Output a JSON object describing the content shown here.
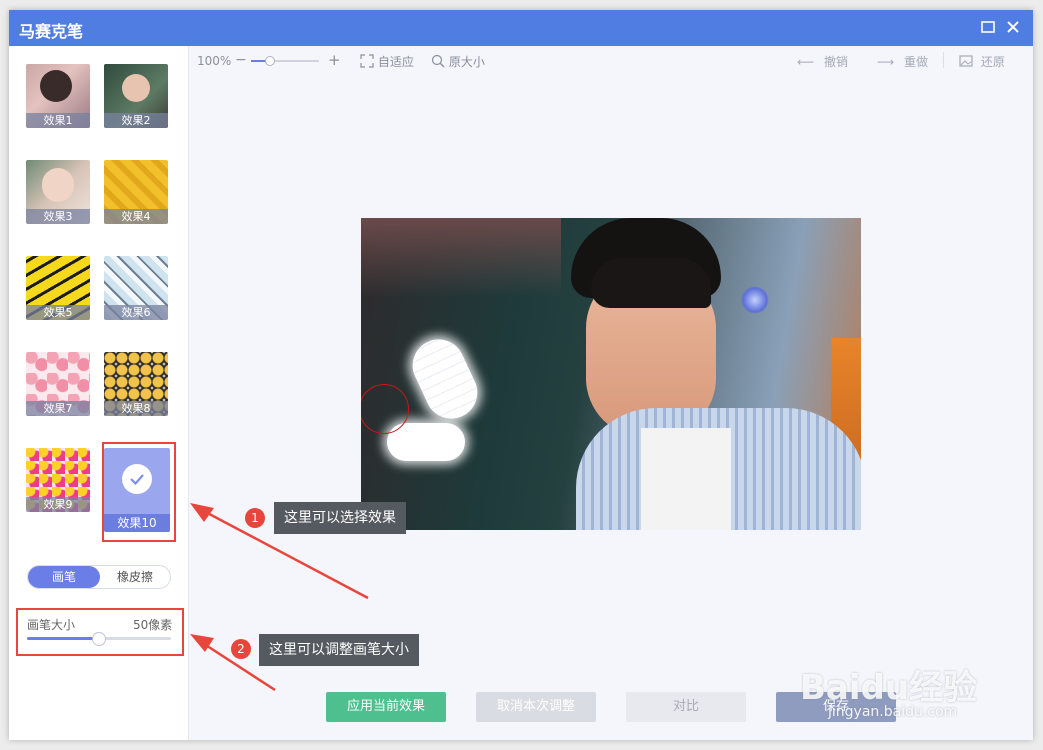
{
  "window": {
    "title": "马赛克笔"
  },
  "effects": [
    {
      "label": "效果1"
    },
    {
      "label": "效果2"
    },
    {
      "label": "效果3"
    },
    {
      "label": "效果4"
    },
    {
      "label": "效果5"
    },
    {
      "label": "效果6"
    },
    {
      "label": "效果7"
    },
    {
      "label": "效果8"
    },
    {
      "label": "效果9"
    },
    {
      "label": "效果10",
      "selected": true
    }
  ],
  "brush_tabs": {
    "brush": "画笔",
    "eraser": "橡皮擦",
    "active": "画笔"
  },
  "brush_size": {
    "label": "画笔大小",
    "value_text": "50像素",
    "slider_fraction": 0.5
  },
  "toolbar": {
    "zoom_text": "100%",
    "fit_label": "自适应",
    "original_label": "原大小",
    "undo_label": "撤销",
    "redo_label": "重做",
    "restore_label": "还原"
  },
  "buttons": {
    "apply": "应用当前效果",
    "cancel": "取消本次调整",
    "compare": "对比",
    "save": "保存"
  },
  "annotations": [
    {
      "num": "1",
      "text": "这里可以选择效果"
    },
    {
      "num": "2",
      "text": "这里可以调整画笔大小"
    }
  ],
  "watermark": {
    "brand": "Baidu经验",
    "url": "jingyan.baidu.com"
  },
  "colors": {
    "titlebar": "#4f7de1",
    "accent": "#6b82e6",
    "apply_button": "#4ec08f",
    "annotation_red": "#e8453c"
  }
}
